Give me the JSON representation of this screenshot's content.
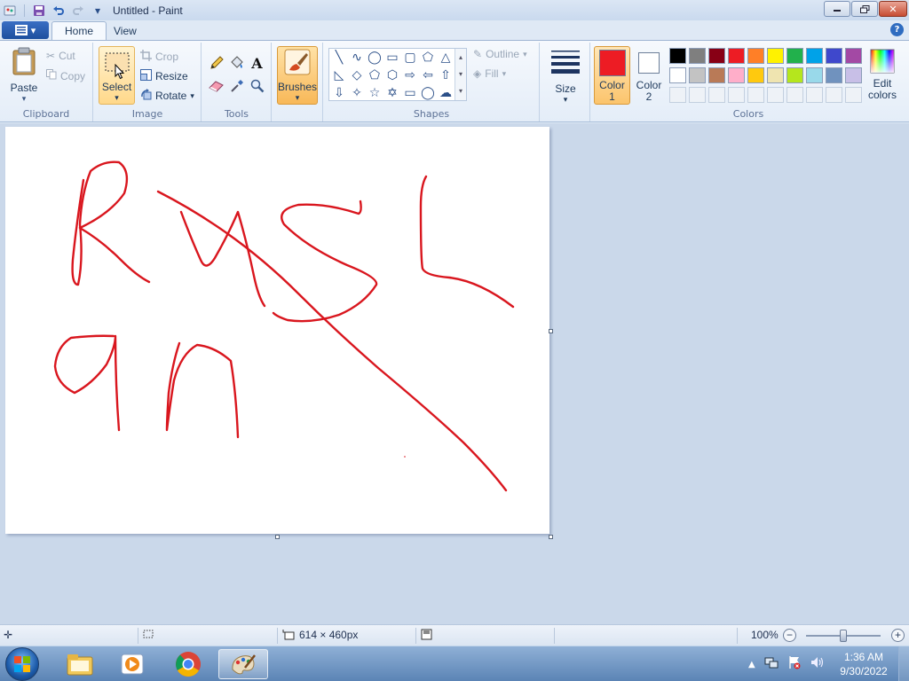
{
  "window": {
    "title": "Untitled - Paint"
  },
  "tabs": {
    "home": "Home",
    "view": "View"
  },
  "ribbon": {
    "clipboard": {
      "label": "Clipboard",
      "paste": "Paste",
      "cut": "Cut",
      "copy": "Copy"
    },
    "image": {
      "label": "Image",
      "select": "Select",
      "crop": "Crop",
      "resize": "Resize",
      "rotate": "Rotate"
    },
    "tools": {
      "label": "Tools"
    },
    "brushes": {
      "label": "Brushes"
    },
    "shapes": {
      "label": "Shapes",
      "outline": "Outline",
      "fill": "Fill"
    },
    "size": {
      "label": "Size"
    },
    "colors": {
      "label": "Colors",
      "color1": "Color\n1",
      "color1_a": "Color",
      "color1_b": "1",
      "color2_a": "Color",
      "color2_b": "2",
      "edit_a": "Edit",
      "edit_b": "colors",
      "color1_value": "#ed1c24",
      "color2_value": "#ffffff",
      "palette_row1": [
        "#000000",
        "#7f7f7f",
        "#880015",
        "#ed1c24",
        "#ff7f27",
        "#fff200",
        "#22b14c",
        "#00a2e8",
        "#3f48cc",
        "#a349a4"
      ],
      "palette_row2": [
        "#ffffff",
        "#c3c3c3",
        "#b97a57",
        "#ffaec9",
        "#ffc90e",
        "#efe4b0",
        "#b5e61d",
        "#99d9ea",
        "#7092be",
        "#c8bfe7"
      ]
    }
  },
  "status": {
    "canvas_size": "614 × 460px",
    "zoom": "100%",
    "zoom_level_percent": 100
  },
  "taskbar": {
    "time": "1:36 AM",
    "date": "9/30/2022"
  },
  "accent": {
    "stroke": "#d9161e",
    "selection": "#ffd48a"
  }
}
